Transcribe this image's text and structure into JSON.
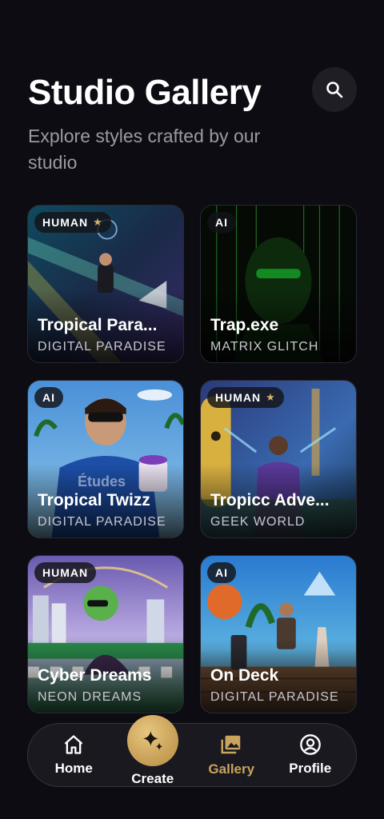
{
  "header": {
    "title": "Studio Gallery",
    "subtitle": "Explore styles crafted by our studio"
  },
  "search": {
    "icon": "search-icon"
  },
  "cards": [
    {
      "badge": "HUMAN",
      "starred": true,
      "title": "Tropical Para...",
      "subtitle": "DIGITAL PARADISE"
    },
    {
      "badge": "AI",
      "starred": false,
      "title": "Trap.exe",
      "subtitle": "MATRIX GLITCH"
    },
    {
      "badge": "AI",
      "starred": false,
      "title": "Tropical Twizz",
      "subtitle": "DIGITAL PARADISE",
      "overlay_text": "Études"
    },
    {
      "badge": "HUMAN",
      "starred": true,
      "title": "Tropicc Adve...",
      "subtitle": "GEEK WORLD"
    },
    {
      "badge": "HUMAN",
      "starred": false,
      "title": "Cyber Dreams",
      "subtitle": "NEON DREAMS"
    },
    {
      "badge": "AI",
      "starred": false,
      "title": "On Deck",
      "subtitle": "DIGITAL PARADISE"
    }
  ],
  "nav": {
    "items": [
      {
        "label": "Home",
        "icon": "home-icon"
      },
      {
        "label": "Create",
        "icon": "sparkle-icon"
      },
      {
        "label": "Gallery",
        "icon": "gallery-icon",
        "active": true
      },
      {
        "label": "Profile",
        "icon": "profile-icon"
      }
    ]
  },
  "colors": {
    "background": "#0d0c12",
    "accent": "#c9a45e"
  }
}
